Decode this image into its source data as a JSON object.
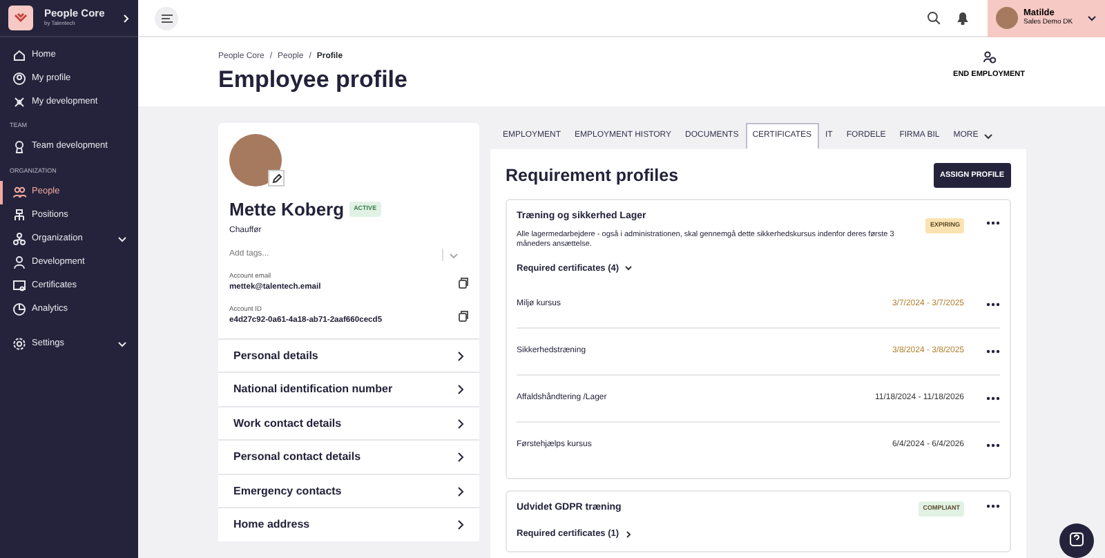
{
  "sidebar": {
    "brand": {
      "name": "People Core",
      "sub": "by Talentech"
    },
    "groups": [
      {
        "items": [
          {
            "label": "Home",
            "selected": false,
            "expandable": false
          },
          {
            "label": "My profile",
            "selected": false,
            "expandable": false
          },
          {
            "label": "My development",
            "selected": false,
            "expandable": false
          }
        ]
      },
      {
        "heading": "TEAM",
        "items": [
          {
            "label": "Team development",
            "selected": false,
            "expandable": false
          }
        ]
      },
      {
        "heading": "ORGANIZATION",
        "items": [
          {
            "label": "People",
            "selected": true,
            "expandable": false
          },
          {
            "label": "Positions",
            "selected": false,
            "expandable": false
          },
          {
            "label": "Organization",
            "selected": false,
            "expandable": true
          },
          {
            "label": "Development",
            "selected": false,
            "expandable": false
          },
          {
            "label": "Certificates",
            "selected": false,
            "expandable": false
          },
          {
            "label": "Analytics",
            "selected": false,
            "expandable": false
          }
        ]
      },
      {
        "items": [
          {
            "label": "Settings",
            "selected": false,
            "expandable": true
          }
        ]
      }
    ]
  },
  "topbar": {
    "user": {
      "name": "Matilde",
      "org": "Sales Demo DK"
    }
  },
  "header": {
    "breadcrumb": [
      "People Core",
      "People",
      "Profile"
    ],
    "separator": "/",
    "title": "Employee profile",
    "action": "END EMPLOYMENT"
  },
  "profile": {
    "name": "Mette Koberg",
    "status": "ACTIVE",
    "job": "Chauffør",
    "tags_placeholder": "Add tags...",
    "fields": [
      {
        "label": "Account email",
        "value": "mettek@talentech.email"
      },
      {
        "label": "Account ID",
        "value": "e4d27c92-0a61-4a18-ab71-2aaf660cecd5"
      }
    ],
    "sections": [
      "Personal details",
      "National identification number",
      "Work contact details",
      "Personal contact details",
      "Emergency contacts",
      "Home address"
    ]
  },
  "tabs": [
    {
      "label": "EMPLOYMENT",
      "selected": false,
      "kind": "tab"
    },
    {
      "label": "EMPLOYMENT HISTORY",
      "selected": false,
      "kind": "tab"
    },
    {
      "label": "DOCUMENTS",
      "selected": false,
      "kind": "tab"
    },
    {
      "label": "CERTIFICATES",
      "selected": true,
      "kind": "tab"
    },
    {
      "label": "IT",
      "selected": false,
      "kind": "tab"
    },
    {
      "label": "FORDELE",
      "selected": false,
      "kind": "tab"
    },
    {
      "label": "FIRMA BIL",
      "selected": false,
      "kind": "tab"
    },
    {
      "label": "MORE",
      "selected": false,
      "kind": "menu"
    }
  ],
  "panel": {
    "title": "Requirement profiles",
    "button": "ASSIGN PROFILE",
    "profiles": [
      {
        "title": "Træning og sikkerhed Lager",
        "description": "Alle lagermedarbejdere - også i administrationen, skal gennemgå dette sikkerhedskursus indenfor deres første 3 måneders ansættelse.",
        "status": "EXPIRING",
        "color": "#fbe2b0",
        "certificates_label": "Required certificates (4)",
        "expanded": true,
        "certificates": [
          {
            "name": "Miljø kursus",
            "dates": "3/7/2024 - 3/7/2025",
            "expiring": true
          },
          {
            "name": "Sikkerhedstræning",
            "dates": "3/8/2024 - 3/8/2025",
            "expiring": true
          },
          {
            "name": "Affaldshåndtering /Lager",
            "dates": "11/18/2024 - 11/18/2026",
            "expiring": false
          },
          {
            "name": "Førstehjælps kursus",
            "dates": "6/4/2024 - 6/4/2026",
            "expiring": false
          }
        ]
      },
      {
        "title": "Udvidet GDPR træning",
        "status": "COMPLIANT",
        "color": "#e1f2e5",
        "certificates_label": "Required certificates (1)",
        "expanded": false
      }
    ]
  }
}
